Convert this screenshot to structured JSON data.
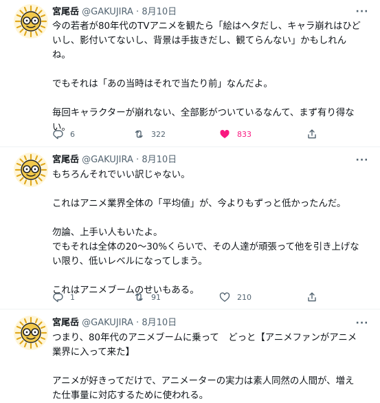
{
  "tweets": [
    {
      "name": "宮尾岳",
      "handle": "@GAKUJIRA",
      "dot": "·",
      "date": "8月10日",
      "text": "今の若者が80年代のTVアニメを観たら「絵はヘタだし、キャラ崩れはひど\nいし、影付いてないし、背景は手抜きだし、観てらんない」かもしれん\nね。\n\nでもそれは「あの当時はそれで当たり前」なんだよ。\n\n毎回キャラクターが崩れない、全部影がついているなんて、まず有り得な\nい。",
      "replies": "6",
      "retweets": "322",
      "likes": "833",
      "liked": true
    },
    {
      "name": "宮尾岳",
      "handle": "@GAKUJIRA",
      "dot": "·",
      "date": "8月10日",
      "text": "もちろんそれでいい訳じゃない。\n\nこれはアニメ業界全体の「平均値」が、今よりもずっと低かったんだ。\n\n勿論、上手い人もいたよ。\nでもそれは全体の20〜30%くらいで、その人達が頑張って他を引き上げな\nい限り、低いレベルになってしまう。\n\nこれはアニメブームのせいもある。",
      "replies": "1",
      "retweets": "91",
      "likes": "210",
      "liked": false
    },
    {
      "name": "宮尾岳",
      "handle": "@GAKUJIRA",
      "dot": "·",
      "date": "8月10日",
      "text": "つまり、80年代のアニメブームに乗って　どっと【アニメファンがアニメ\n業界に入って来た】\n\nアニメが好きってだけで、アニメーターの実力は素人同然の人間が、増え\nた仕事量に対応するために使われる。",
      "replies": "",
      "retweets": "",
      "likes": "",
      "liked": false
    }
  ],
  "icons": {
    "more": "more-horizontal-icon",
    "reply": "reply-icon",
    "retweet": "retweet-icon",
    "like": "heart-icon",
    "share": "share-icon"
  },
  "colors": {
    "like_active": "#f91880",
    "secondary_text": "#536471",
    "avatar_sun": "#f2c94c"
  }
}
